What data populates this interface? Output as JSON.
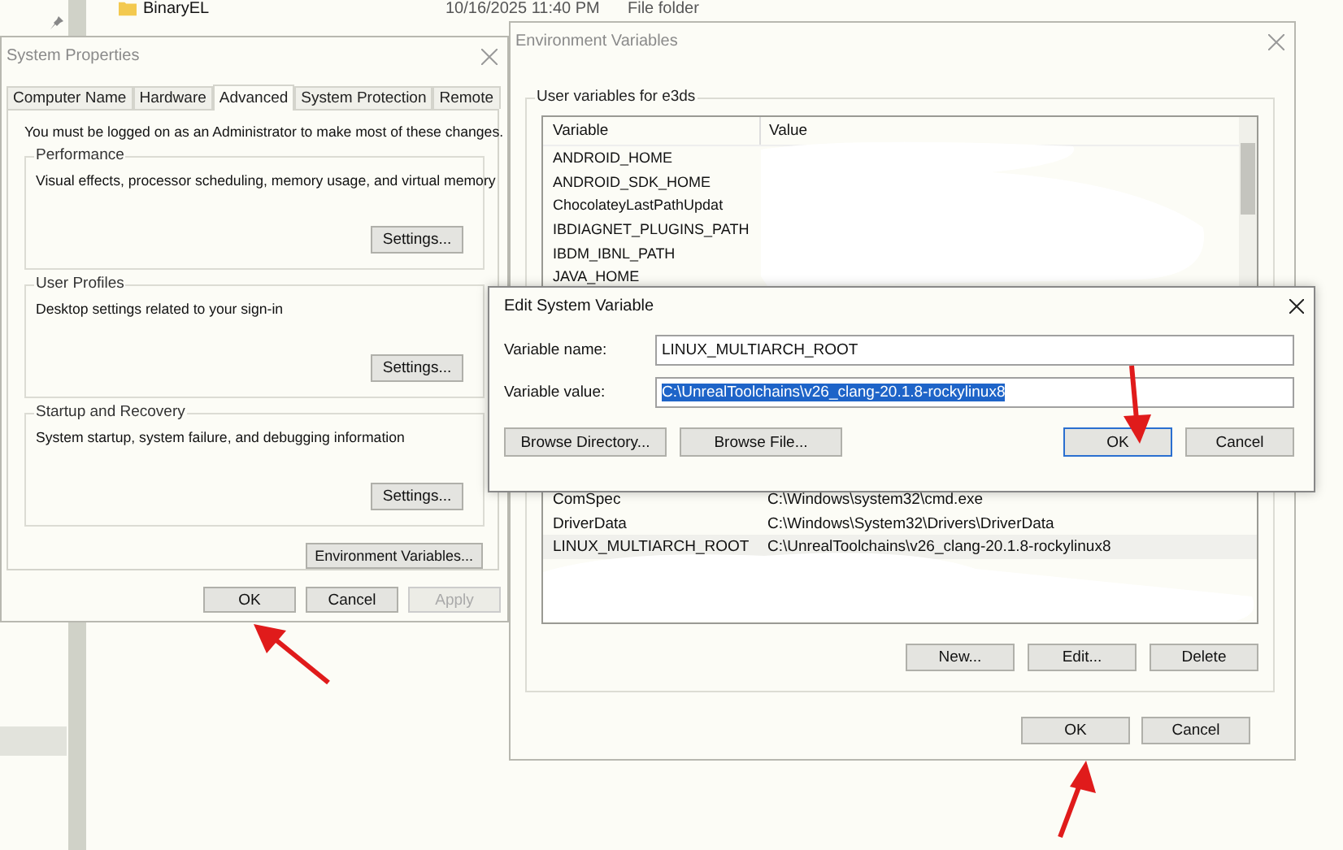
{
  "explorer": {
    "rows": [
      {
        "name": "BinaryEL",
        "date": "10/16/2025 11:40 PM",
        "type": "File folder"
      }
    ]
  },
  "system_properties": {
    "title": "System Properties",
    "tabs": [
      {
        "label": "Computer Name",
        "selected": false
      },
      {
        "label": "Hardware",
        "selected": false
      },
      {
        "label": "Advanced",
        "selected": true
      },
      {
        "label": "System Protection",
        "selected": false
      },
      {
        "label": "Remote",
        "selected": false
      }
    ],
    "notice": "You must be logged on as an Administrator to make most of these changes.",
    "groups": [
      {
        "title": "Performance",
        "description": "Visual effects, processor scheduling, memory usage, and virtual memory",
        "button": "Settings..."
      },
      {
        "title": "User Profiles",
        "description": "Desktop settings related to your sign-in",
        "button": "Settings..."
      },
      {
        "title": "Startup and Recovery",
        "description": "System startup, system failure, and debugging information",
        "button": "Settings..."
      }
    ],
    "env_button": "Environment Variables...",
    "buttons": [
      {
        "label": "OK",
        "disabled": false
      },
      {
        "label": "Cancel",
        "disabled": false
      },
      {
        "label": "Apply",
        "disabled": true
      }
    ]
  },
  "environment_variables": {
    "title": "Environment Variables",
    "user_group": "User variables for e3ds",
    "columns": [
      "Variable",
      "Value"
    ],
    "user_rows": [
      {
        "variable": "ANDROID_HOME"
      },
      {
        "variable": "ANDROID_SDK_HOME"
      },
      {
        "variable": "ChocolateyLastPathUpdat"
      },
      {
        "variable": "IBDIAGNET_PLUGINS_PATH"
      },
      {
        "variable": "IBDM_IBNL_PATH"
      },
      {
        "variable": "JAVA_HOME"
      }
    ],
    "system_rows": [
      {
        "variable": "ComSpec",
        "value": "C:\\Windows\\system32\\cmd.exe",
        "selected": false
      },
      {
        "variable": "DriverData",
        "value": "C:\\Windows\\System32\\Drivers\\DriverData",
        "selected": false
      },
      {
        "variable": "LINUX_MULTIARCH_ROOT",
        "value": "C:\\UnrealToolchains\\v26_clang-20.1.8-rockylinux8",
        "selected": true
      }
    ],
    "list_buttons": [
      "New...",
      "Edit...",
      "Delete"
    ],
    "buttons": [
      "OK",
      "Cancel"
    ]
  },
  "edit_dialog": {
    "title": "Edit System Variable",
    "fields": [
      {
        "label": "Variable name:",
        "value": "LINUX_MULTIARCH_ROOT",
        "selected": false
      },
      {
        "label": "Variable value:",
        "value": "C:\\UnrealToolchains\\v26_clang-20.1.8-rockylinux8",
        "selected": true
      }
    ],
    "left_buttons": [
      "Browse Directory...",
      "Browse File..."
    ],
    "buttons": [
      {
        "label": "OK",
        "default": true
      },
      {
        "label": "Cancel",
        "default": false
      }
    ]
  }
}
